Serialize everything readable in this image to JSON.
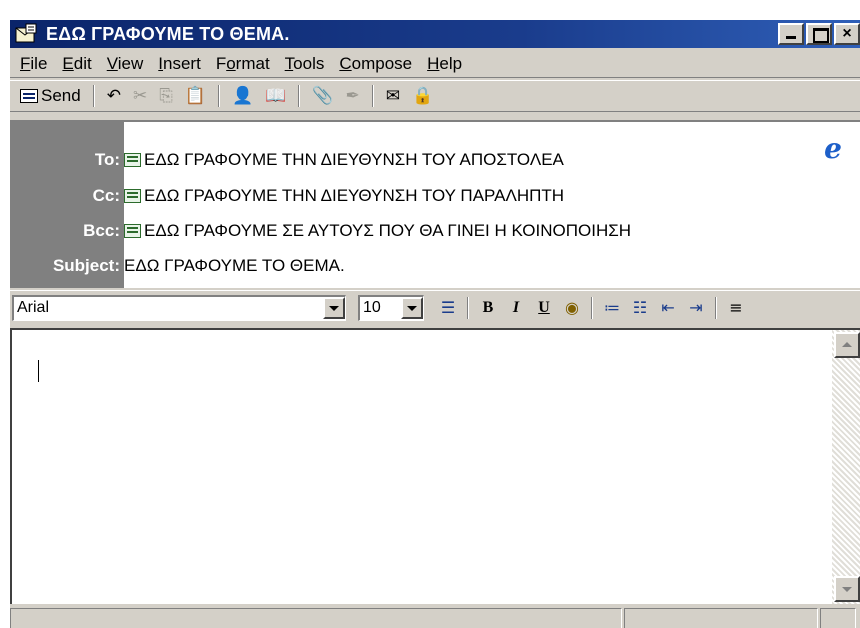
{
  "window": {
    "title": "ΕΔΩ ΓΡΑΦΟΥΜΕ ΤΟ ΘΕΜΑ.",
    "icon": "new-message-icon",
    "close_glyph": "×"
  },
  "menu": {
    "items": [
      {
        "pre": "",
        "key": "F",
        "post": "ile"
      },
      {
        "pre": "",
        "key": "E",
        "post": "dit"
      },
      {
        "pre": "",
        "key": "V",
        "post": "iew"
      },
      {
        "pre": "",
        "key": "I",
        "post": "nsert"
      },
      {
        "pre": "F",
        "key": "o",
        "post": "rmat"
      },
      {
        "pre": "",
        "key": "T",
        "post": "ools"
      },
      {
        "pre": "",
        "key": "C",
        "post": "ompose"
      },
      {
        "pre": "",
        "key": "H",
        "post": "elp"
      }
    ]
  },
  "toolbar": {
    "send_label": "Send",
    "undo_glyph": "↶",
    "cut_glyph": "✂",
    "copy_glyph": "⎘",
    "paste_glyph": "📋",
    "check_names_glyph": "👤",
    "address_book_glyph": "📖",
    "attach_glyph": "📎",
    "sign_glyph": "✒",
    "encrypt_glyph": "✉",
    "offline_glyph": "🔒"
  },
  "headers": {
    "to_label": "To:",
    "to_value": "ΕΔΩ ΓΡΑΦΟΥΜΕ ΤΗΝ ΔΙΕΥΘΥΝΣΗ ΤΟΥ ΑΠΟΣΤΟΛΕΑ",
    "cc_label": "Cc:",
    "cc_value": "ΕΔΩ ΓΡΑΦΟΥΜΕ ΤΗΝ ΔΙΕΥΘΥΝΣΗ ΤΟΥ ΠΑΡΑΛΗΠΤΗ",
    "bcc_label": "Bcc:",
    "bcc_value": "ΕΔΩ ΓΡΑΦΟΥΜΕ ΣΕ ΑΥΤΟΥΣ ΠΟΥ ΘΑ ΓΙΝΕΙ Η ΚΟΙΝΟΠΟΙΗΣΗ",
    "subject_label": "Subject:",
    "subject_value": "ΕΔΩ ΓΡΑΦΟΥΜΕ ΤΟ ΘΕΜΑ.",
    "ie_logo": "e"
  },
  "format": {
    "font_name": "Arial",
    "font_size": "10",
    "paragraph_style_glyph": "☰",
    "bold_glyph": "B",
    "italic_glyph": "I",
    "underline_glyph": "U",
    "font_color_glyph": "◉",
    "numbered_list_glyph": "≔",
    "bulleted_list_glyph": "☷",
    "decrease_indent_glyph": "⇤",
    "increase_indent_glyph": "⇥",
    "align_glyph": "≡"
  },
  "body": {
    "text": ""
  },
  "colors": {
    "titlebar": "#0a246a",
    "chrome": "#d4d0c8",
    "header_label_bg": "#808080"
  }
}
